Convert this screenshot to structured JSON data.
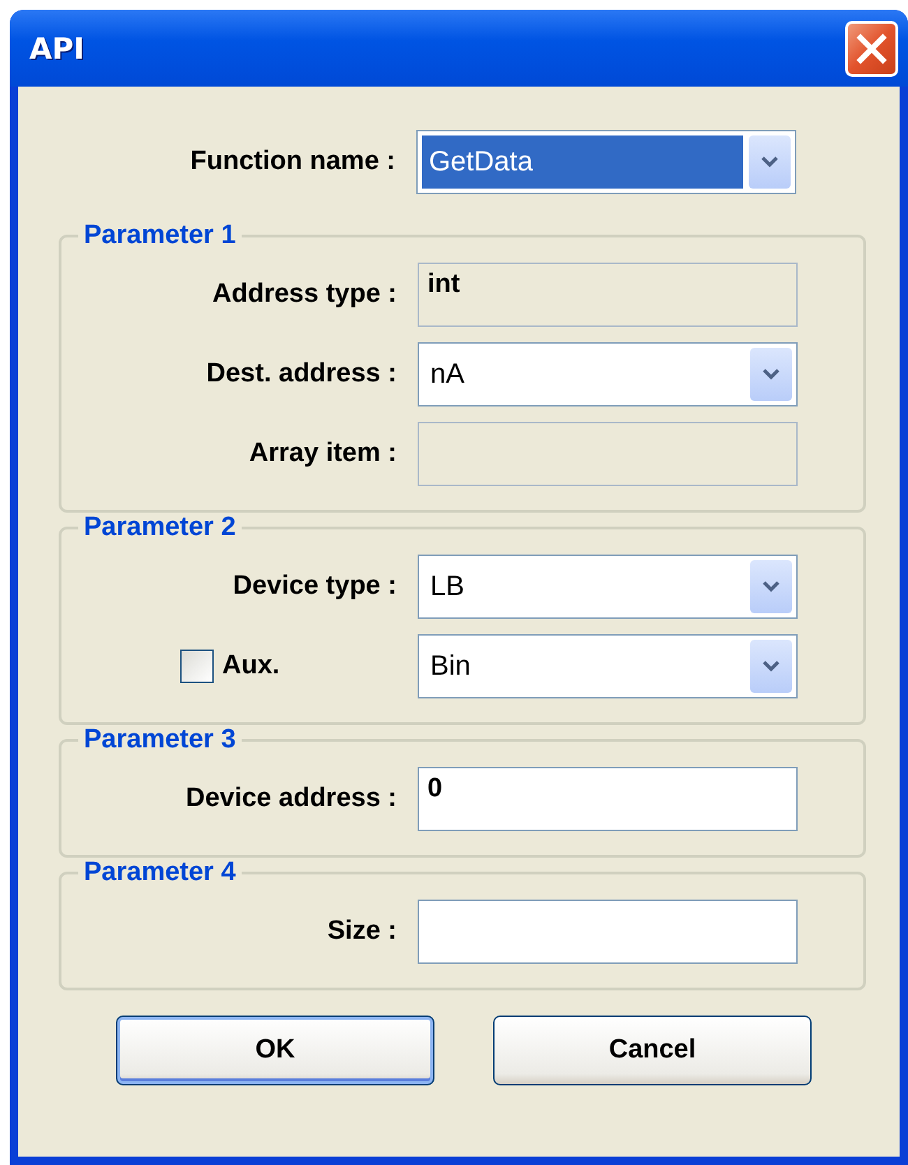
{
  "window": {
    "title": "API"
  },
  "function_name": {
    "label": "Function name :",
    "value": "GetData",
    "selected": true
  },
  "groups": [
    {
      "title": "Parameter 1",
      "rows": [
        {
          "kind": "text",
          "label": "Address type :",
          "value": "int",
          "disabled": true
        },
        {
          "kind": "combo",
          "label": "Dest. address :",
          "value": "nA",
          "disabled": false
        },
        {
          "kind": "text",
          "label": "Array item :",
          "disabled": true
        }
      ]
    },
    {
      "title": "Parameter 2",
      "rows": [
        {
          "kind": "combo",
          "label": "Device type :",
          "value": "LB",
          "disabled": false
        },
        {
          "kind": "check-combo",
          "label": "Aux.",
          "checked": false,
          "value": "Bin",
          "disabled": false
        }
      ]
    },
    {
      "title": "Parameter 3",
      "rows": [
        {
          "kind": "text",
          "label": "Device address :",
          "value": "0",
          "disabled": false
        }
      ]
    },
    {
      "title": "Parameter 4",
      "rows": [
        {
          "kind": "text",
          "label": "Size :",
          "disabled": false
        }
      ]
    }
  ],
  "buttons": [
    {
      "label": "OK",
      "default": true
    },
    {
      "label": "Cancel",
      "default": false
    }
  ]
}
